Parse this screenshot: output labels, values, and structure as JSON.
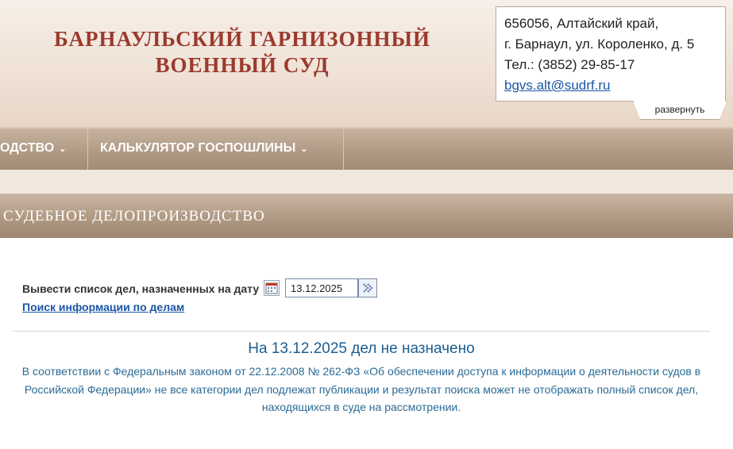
{
  "header": {
    "court_name_line1": "БАРНАУЛЬСКИЙ ГАРНИЗОННЫЙ",
    "court_name_line2": "ВОЕННЫЙ СУД"
  },
  "contacts": {
    "address_line1": "656056, Алтайский край,",
    "address_line2": "г. Барнаул, ул. Короленко, д. 5",
    "phone": "Тел.: (3852) 29-85-17",
    "email": "bgvs.alt@sudrf.ru",
    "expand_label": "развернуть"
  },
  "nav": {
    "items": [
      {
        "label": "ОДСТВО",
        "icon": "chevron-down-icon"
      },
      {
        "label": "КАЛЬКУЛЯТОР ГОСПОШЛИНЫ",
        "icon": "chevron-down-icon"
      }
    ]
  },
  "section": {
    "title": "СУДЕБНОЕ ДЕЛОПРОИЗВОДСТВО"
  },
  "search": {
    "date_label": "Вывести список дел, назначенных на дату",
    "date_value": "13.12.2025",
    "calendar_icon": "calendar-icon",
    "go_icon": "arrow-right-icon",
    "info_link": "Поиск информации по делам"
  },
  "result": {
    "title": "На 13.12.2025 дел не назначено",
    "note": "В соответствии с Федеральным законом от 22.12.2008 № 262-ФЗ «Об обеспечении доступа к информации о деятельности судов в Российской Федерации» не все категории дел подлежат публикации и результат поиска может не отображать полный список дел, находящихся в суде на рассмотрении."
  }
}
